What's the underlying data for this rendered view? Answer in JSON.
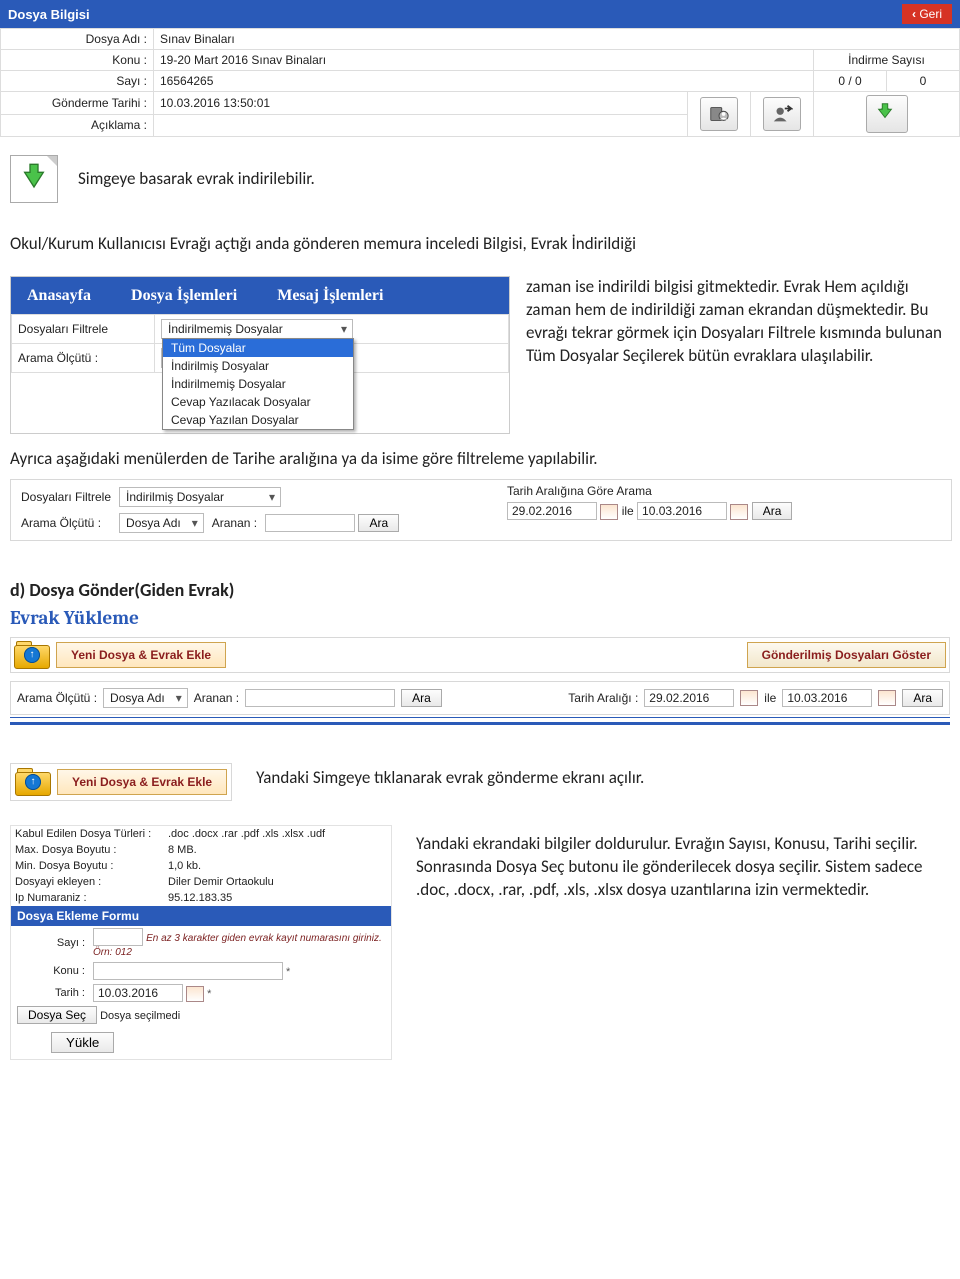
{
  "dosyaBilgisi": {
    "title": "Dosya Bilgisi",
    "back": "Geri",
    "labels": {
      "dosyaAdi": "Dosya Adı :",
      "konu": "Konu :",
      "sayi": "Sayı :",
      "gondermeTarihi": "Gönderme Tarihi :",
      "aciklama": "Açıklama :",
      "indirmeSayisi": "İndirme Sayısı"
    },
    "values": {
      "dosyaAdi": "Sınav Binaları",
      "konu": "19-20 Mart 2016 Sınav Binaları",
      "sayi": "16564265",
      "gondermeTarihi": "10.03.2016 13:50:01",
      "aciklama": "",
      "indirmeOran": "0 / 0",
      "indirmeSayisiVal": "0"
    }
  },
  "docText": {
    "line1": "Simgeye basarak evrak indirilebilir.",
    "para2a": "Okul/Kurum Kullanıcısı Evrağı açtığı anda gönderen memura inceledi Bilgisi, Evrak İndirildiği",
    "para2b": "zaman ise indirildi bilgisi gitmektedir. Evrak Hem açıldığı zaman hem de indirildiği zaman ekrandan düşmektedir. Bu evrağı tekrar görmek için Dosyaları Filtrele kısmında bulunan Tüm Dosyalar Seçilerek bütün evraklara ulaşılabilir.",
    "para3": "Ayrıca aşağıdaki menülerden de Tarihe aralığına ya da isime göre filtreleme yapılabilir.",
    "sectionD": "d) Dosya Gönder(Giden Evrak)",
    "evrakYukleme": "Evrak Yükleme",
    "yeniDosya": "Yeni Dosya & Evrak Ekle",
    "gonderilmis": "Gönderilmiş Dosyaları Göster",
    "para4": "Yandaki Simgeye tıklanarak evrak gönderme ekranı açılır.",
    "para5": "Yandaki ekrandaki bilgiler doldurulur. Evrağın Sayısı, Konusu, Tarihi seçilir. Sonrasında Dosya Seç butonu ile gönderilecek dosya seçilir. Sistem sadece .doc, .docx, .rar, .pdf, .xls, .xlsx dosya uzantılarına izin vermektedir."
  },
  "navMenu": {
    "anasayfa": "Anasayfa",
    "dosya": "Dosya İşlemleri",
    "mesaj": "Mesaj İşlemleri"
  },
  "filter1": {
    "dosyaFiltrele": "Dosyaları Filtrele",
    "aramaOlcutu": "Arama Ölçütü :",
    "dosyaAdi": "Dosya Adı",
    "selected": "İndirilmemiş Dosyalar",
    "options": [
      "Tüm Dosyalar",
      "İndirilmiş Dosyalar",
      "İndirilmemiş Dosyalar",
      "Cevap Yazılacak Dosyalar",
      "Cevap Yazılan Dosyalar"
    ]
  },
  "filter2": {
    "dosyaFiltrele": "Dosyaları Filtrele",
    "indirilmis": "İndirilmiş Dosyalar",
    "aramaOlcutu": "Arama Ölçütü :",
    "dosyaAdi": "Dosya Adı",
    "aranan": "Aranan :",
    "ara": "Ara",
    "tarihAraligi": "Tarih Aralığına Göre Arama",
    "d1": "29.02.2016",
    "ile": "ile",
    "d2": "10.03.2016"
  },
  "searchStrip": {
    "aramaOlcutu": "Arama Ölçütü :",
    "dosyaAdi": "Dosya Adı",
    "aranan": "Aranan :",
    "ara": "Ara",
    "tarihAraligi": "Tarih Aralığı :",
    "d1": "29.02.2016",
    "ile": "ile",
    "d2": "10.03.2016"
  },
  "formShot": {
    "kabul": "Kabul Edilen Dosya Türleri :",
    "kabulVal": ".doc .docx .rar .pdf .xls .xlsx .udf",
    "maxBoyut": "Max. Dosya Boyutu :",
    "maxBoyutVal": "8 MB.",
    "minBoyut": "Min. Dosya Boyutu :",
    "minBoyutVal": "1,0 kb.",
    "ekleyen": "Dosyayi ekleyen :",
    "ekleyenVal": "Diler Demir Ortaokulu",
    "ip": "Ip Numaraniz :",
    "ipVal": "95.12.183.35",
    "formHdr": "Dosya Ekleme Formu",
    "sayi": "Sayı :",
    "sayiHint": "En az 3 karakter giden evrak kayıt numarasını giriniz. Örn: 012",
    "konu": "Konu :",
    "tarih": "Tarih :",
    "tarihVal": "10.03.2016",
    "dosyaSec": "Dosya Seç",
    "dosyaSecilmedi": "Dosya seçilmedi",
    "yukle": "Yükle"
  }
}
